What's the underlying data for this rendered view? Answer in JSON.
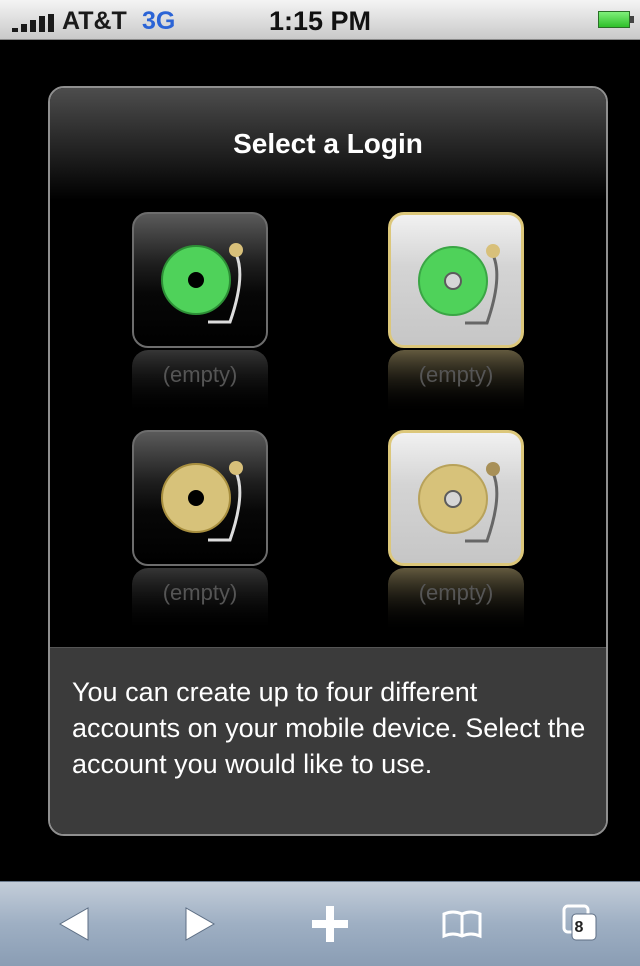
{
  "status_bar": {
    "carrier": "AT&T",
    "network": "3G",
    "time": "1:15 PM"
  },
  "dialog": {
    "title": "Select a Login",
    "logins": [
      {
        "label": "(empty)",
        "style": "dark",
        "color": "#4fd25a"
      },
      {
        "label": "(empty)",
        "style": "light",
        "color": "#4fd25a"
      },
      {
        "label": "(empty)",
        "style": "dark",
        "color": "#d7c27a"
      },
      {
        "label": "(empty)",
        "style": "light",
        "color": "#d7c27a"
      }
    ],
    "info": "You can create up to four different accounts on your mobile device. Select the account you would like to use."
  },
  "toolbar": {
    "tabs_count": "8"
  },
  "icons": {
    "back": "back-arrow-icon",
    "forward": "forward-arrow-icon",
    "add": "plus-icon",
    "bookmarks": "open-book-icon",
    "pages": "pages-icon"
  }
}
